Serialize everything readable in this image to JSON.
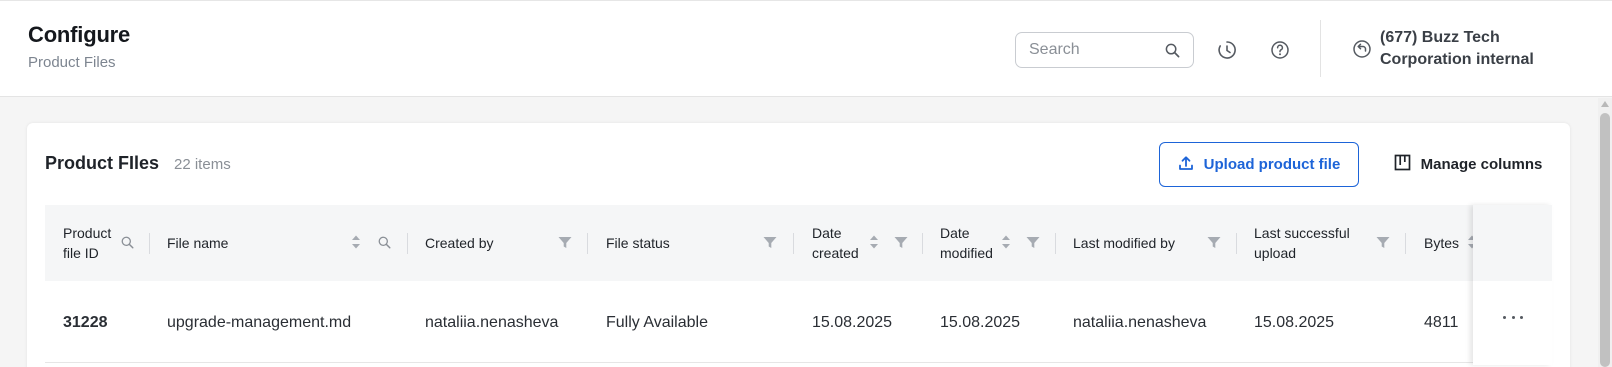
{
  "header": {
    "title": "Configure",
    "subtitle": "Product Files",
    "search": {
      "placeholder": "Search",
      "value": ""
    },
    "icons": [
      "search-icon",
      "history-icon",
      "help-icon",
      "switch-org-icon"
    ],
    "organization": "(677) Buzz Tech Corporation internal"
  },
  "card": {
    "title": "Product FIles",
    "count": "22 items",
    "upload_label": "Upload product file",
    "manage_label": "Manage columns"
  },
  "table": {
    "columns": [
      {
        "key": "id",
        "label": "Product file ID",
        "label_lines": [
          "Product",
          "file ID"
        ],
        "search": true
      },
      {
        "key": "file_name",
        "label": "File name",
        "sort": true,
        "search": true
      },
      {
        "key": "created_by",
        "label": "Created by",
        "filter": true
      },
      {
        "key": "file_status",
        "label": "File status",
        "filter": true
      },
      {
        "key": "date_created",
        "label": "Date created",
        "label_lines": [
          "Date",
          "created"
        ],
        "sort": true,
        "filter": true
      },
      {
        "key": "date_modified",
        "label": "Date modified",
        "label_lines": [
          "Date",
          "modified"
        ],
        "sort": true,
        "filter": true
      },
      {
        "key": "last_modified_by",
        "label": "Last modified by",
        "filter": true
      },
      {
        "key": "last_successful_upload",
        "label": "Last successful upload",
        "label_lines": [
          "Last successful",
          "upload"
        ],
        "filter": true
      },
      {
        "key": "bytes",
        "label": "Bytes",
        "sort": true
      }
    ],
    "rows": [
      {
        "id": "31228",
        "file_name": "upgrade-management.md",
        "created_by": "nataliia.nenasheva",
        "file_status": "Fully Available",
        "date_created": "15.08.2025",
        "date_modified": "15.08.2025",
        "last_modified_by": "nataliia.nenasheva",
        "last_successful_upload": "15.08.2025",
        "bytes": "4811"
      }
    ]
  },
  "colors": {
    "accent": "#1d64d8",
    "header_bg": "#f5f6f7",
    "page_bg": "#f5f5f5"
  }
}
